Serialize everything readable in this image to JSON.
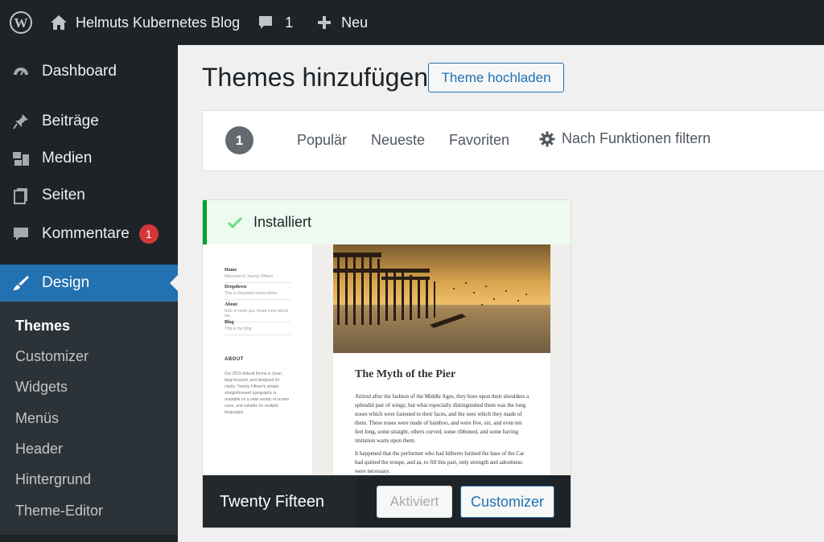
{
  "adminbar": {
    "site_name": "Helmuts Kubernetes Blog",
    "comments_count": "1",
    "new_label": "Neu"
  },
  "sidebar": {
    "items": [
      {
        "label": "Dashboard",
        "icon": "dashboard-icon"
      },
      {
        "label": "Beiträge",
        "icon": "pin-icon"
      },
      {
        "label": "Medien",
        "icon": "media-icon"
      },
      {
        "label": "Seiten",
        "icon": "pages-icon"
      },
      {
        "label": "Kommentare",
        "icon": "comment-icon",
        "badge": "1"
      },
      {
        "label": "Design",
        "icon": "brush-icon"
      }
    ],
    "submenu": [
      "Themes",
      "Customizer",
      "Widgets",
      "Menüs",
      "Header",
      "Hintergrund",
      "Theme-Editor"
    ]
  },
  "main": {
    "title": "Themes hinzufügen",
    "upload_button": "Theme hochladen",
    "filter": {
      "count": "1",
      "links": [
        "Populär",
        "Neueste",
        "Favoriten"
      ],
      "features": "Nach Funktionen filtern"
    }
  },
  "theme": {
    "notice": "Installiert",
    "name": "Twenty Fifteen",
    "activated_label": "Aktiviert",
    "customizer_label": "Customizer",
    "preview": {
      "nav": [
        {
          "title": "Home",
          "sub": "Welcome to Twenty Fifteen"
        },
        {
          "title": "Dropdown",
          "sub": "This is dropdown menu items."
        },
        {
          "title": "About",
          "sub": "Nice to meet you. Read more about me."
        },
        {
          "title": "Blog",
          "sub": "This is my blog."
        }
      ],
      "about_heading": "ABOUT",
      "about_text": "Our 2015 default theme is clean, blog-focused, and designed for clarity. Twenty Fifteen's simple, straightforward typography is readable on a wide variety of screen sizes, and suitable for multiple languages.",
      "post_title": "The Myth of the Pier",
      "paragraph1": "Attired after the fashion of the Middle Ages, they bore upon their shoulders a splendid pair of wings; but what especially distinguished them was the long noses which were fastened to their faces, and the uses which they made of them. These noses were made of bamboo, and were five, six, and even ten feet long, some straight, others curved, some ribboned, and some having imitation warts upon them.",
      "paragraph2": "It happened that the performer who had hitherto formed the base of the Car had quitted the troupe, and as, to fill this part, only strength and adroitness were necessary."
    }
  },
  "colors": {
    "adminbar": "#1d2327",
    "accent": "#2271b1",
    "notice_border": "#00a32a",
    "badge": "#d63638"
  }
}
